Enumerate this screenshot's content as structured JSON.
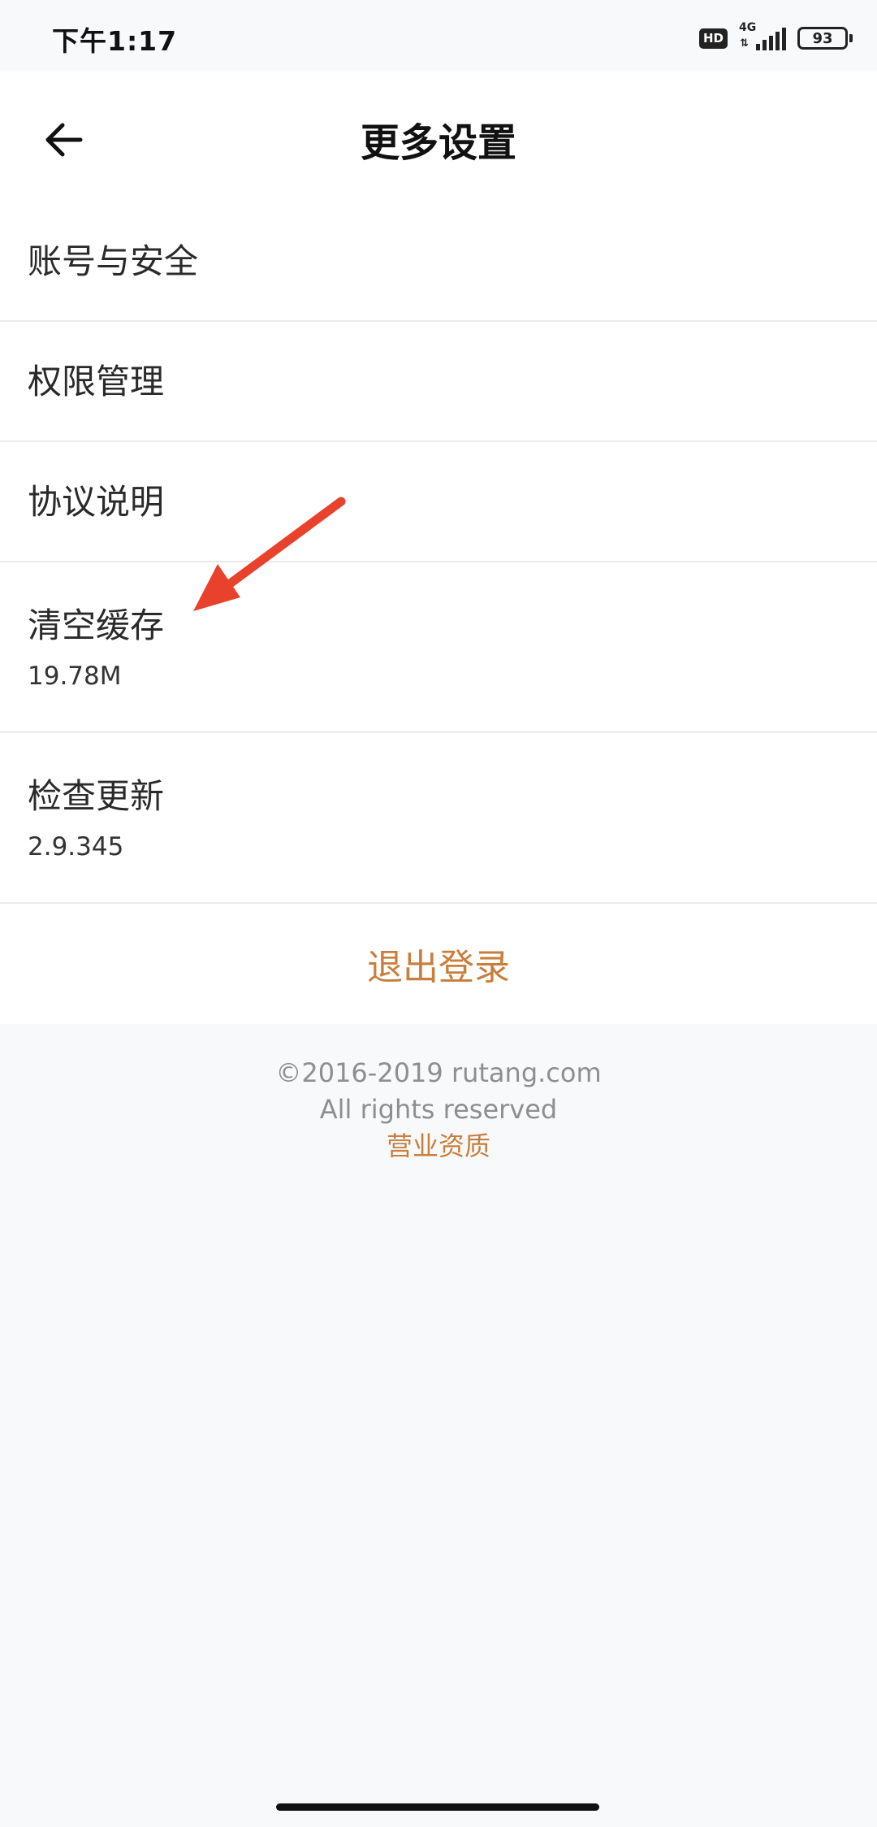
{
  "status_bar": {
    "time": "下午1:17",
    "hd_label": "HD",
    "network": "4G",
    "battery": "93"
  },
  "header": {
    "title": "更多设置",
    "back_icon": "arrow-left-icon"
  },
  "menu": {
    "items": [
      {
        "label": "账号与安全"
      },
      {
        "label": "权限管理"
      },
      {
        "label": "协议说明"
      },
      {
        "label": "清空缓存",
        "value": "19.78M"
      },
      {
        "label": "检查更新",
        "value": "2.9.345"
      }
    ],
    "logout_label": "退出登录"
  },
  "footer": {
    "copyright": "©2016-2019 rutang.com",
    "rights": "All rights reserved",
    "license_link": "营业资质"
  },
  "colors": {
    "accent": "#c97e3c",
    "annotation_arrow": "#e8412c",
    "background": "#f7f9fa"
  }
}
